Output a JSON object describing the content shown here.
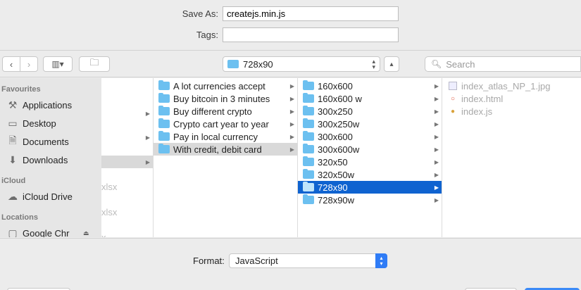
{
  "save_as": {
    "label": "Save As:",
    "value": "createjs.min.js"
  },
  "tags": {
    "label": "Tags:",
    "value": ""
  },
  "toolbar": {
    "back_icon": "chevron-left-icon",
    "forward_icon": "chevron-right-icon",
    "view_icon": "column-view-icon",
    "new_folder_icon": "new-folder-icon",
    "location": "728x90",
    "search_placeholder": "Search"
  },
  "sidebar": {
    "favourites_header": "Favourites",
    "favourites": [
      {
        "label": "Applications",
        "icon": "applications-icon"
      },
      {
        "label": "Desktop",
        "icon": "desktop-icon"
      },
      {
        "label": "Documents",
        "icon": "documents-icon"
      },
      {
        "label": "Downloads",
        "icon": "downloads-icon"
      }
    ],
    "icloud_header": "iCloud",
    "icloud": [
      {
        "label": "iCloud Drive",
        "icon": "cloud-icon"
      }
    ],
    "locations_header": "Locations",
    "locations": [
      {
        "label": "Google Chr",
        "icon": "disk-icon"
      }
    ]
  },
  "columns": {
    "col0_partial": [
      "xlsx",
      "xlsx",
      "x"
    ],
    "col1": [
      "A lot currencies accept",
      "Buy bitcoin in 3 minutes",
      "Buy different crypto",
      "Crypto cart year to year",
      "Pay in local currency",
      "With credit, debit card"
    ],
    "col2": [
      "160x600",
      "160x600 w",
      "300x250",
      "300x250w",
      "300x600",
      "300x600w",
      "320x50",
      "320x50w",
      "728x90",
      "728x90w"
    ],
    "col3": [
      "index_atlas_NP_1.jpg",
      "index.html",
      "index.js"
    ]
  },
  "format": {
    "label": "Format:",
    "value": "JavaScript"
  },
  "colors": {
    "selection": "#0f63d0",
    "folder": "#6cc0f0",
    "accent": "#2f7cf6"
  }
}
